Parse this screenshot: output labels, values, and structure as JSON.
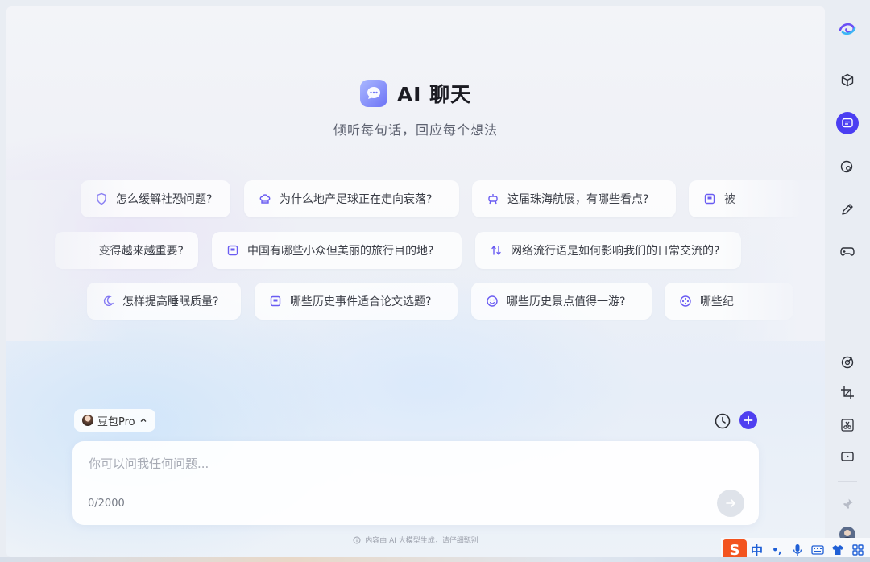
{
  "hero": {
    "title": "AI 聊天",
    "subtitle": "倾听每句话，回应每个想法"
  },
  "suggestions": {
    "row1": [
      {
        "icon": "shield-icon",
        "text": "怎么缓解社恐问题?"
      },
      {
        "icon": "chef-hat-icon",
        "text": "为什么地产足球正在走向衰落?"
      },
      {
        "icon": "robot-icon",
        "text": "这届珠海航展，有哪些看点?"
      },
      {
        "icon": "note-icon",
        "text": "被"
      }
    ],
    "row2": [
      {
        "icon": "",
        "text": "变得越来越重要?"
      },
      {
        "icon": "note-icon",
        "text": "中国有哪些小众但美丽的旅行目的地?"
      },
      {
        "icon": "updown-arrows-icon",
        "text": "网络流行语是如何影响我们的日常交流的?"
      }
    ],
    "row3": [
      {
        "icon": "moon-icon",
        "text": "怎样提高睡眠质量?"
      },
      {
        "icon": "note-icon",
        "text": "哪些历史事件适合论文选题?"
      },
      {
        "icon": "smile-icon",
        "text": "哪些历史景点值得一游?"
      },
      {
        "icon": "film-reel-icon",
        "text": "哪些纪"
      }
    ]
  },
  "composer": {
    "model_label": "豆包Pro",
    "placeholder": "你可以问我任何问题...",
    "counter": "0/2000",
    "footnote": "内容由 AI 大模型生成，请仔细甄别"
  },
  "ime": {
    "logo": "S",
    "lang": "中",
    "punct": "•,"
  },
  "colors": {
    "accent": "#4b3ef2",
    "send_disabled": "#dfe3ea"
  }
}
